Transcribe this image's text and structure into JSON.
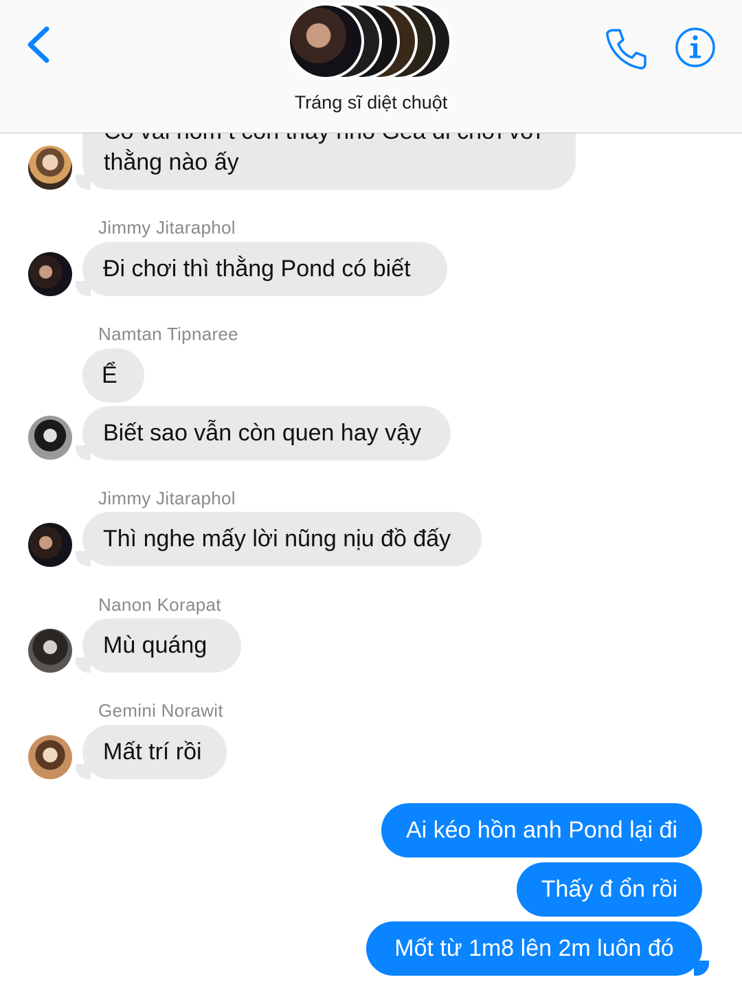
{
  "header": {
    "group_name": "Tráng sĩ diệt chuột",
    "back_icon": "chevron-left-icon",
    "call_icon": "phone-icon",
    "info_icon": "info-icon",
    "accent_color": "#0b84ff"
  },
  "messages": [
    {
      "direction": "in",
      "lines": [
        "Có vài hôm t còn thấy nhỏ Gea đi chơi với",
        "thằng nào ấy"
      ]
    },
    {
      "direction": "in",
      "sender": "Jimmy Jitaraphol",
      "text": "Đi chơi thì thằng Pond có biết"
    },
    {
      "direction": "in",
      "sender": "Namtan Tipnaree",
      "text": "Ể"
    },
    {
      "direction": "in",
      "text": "Biết sao vẫn còn quen hay vậy"
    },
    {
      "direction": "in",
      "sender": "Jimmy Jitaraphol",
      "text": "Thì nghe mấy lời nũng nịu đồ đấy"
    },
    {
      "direction": "in",
      "sender": "Nanon Korapat",
      "text": "Mù quáng"
    },
    {
      "direction": "in",
      "sender": "Gemini Norawit",
      "text": "Mất trí rồi"
    },
    {
      "direction": "out",
      "text": "Ai kéo hồn anh Pond lại đi"
    },
    {
      "direction": "out",
      "text": "Thấy đ ổn rồi"
    },
    {
      "direction": "out",
      "text": "Mốt từ 1m8 lên 2m luôn đó"
    }
  ],
  "colors": {
    "incoming_bubble": "#e9e9eb",
    "outgoing_bubble": "#0b84ff",
    "sender_label": "#8a8a8e"
  }
}
